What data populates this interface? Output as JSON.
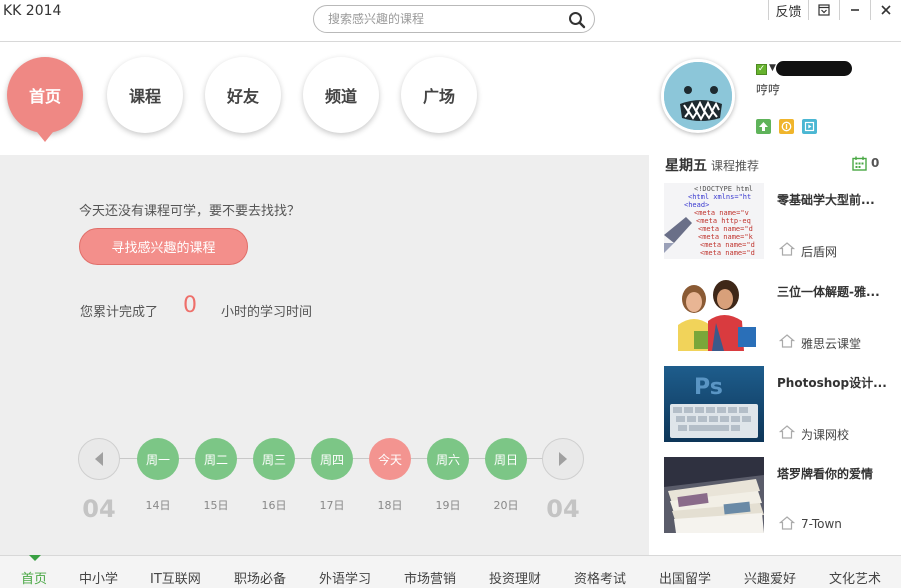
{
  "app": {
    "title": "KK 2014"
  },
  "search": {
    "placeholder": "搜索感兴趣的课程",
    "icon": "search-icon"
  },
  "window_controls": {
    "feedback": "反馈",
    "icons": [
      "dropdown-icon",
      "minimize-icon",
      "close-icon"
    ]
  },
  "nav": {
    "items": [
      {
        "label": "首页",
        "active": true
      },
      {
        "label": "课程",
        "active": false
      },
      {
        "label": "好友",
        "active": false
      },
      {
        "label": "频道",
        "active": false
      },
      {
        "label": "广场",
        "active": false
      }
    ],
    "accent_color": "#ef8884"
  },
  "user": {
    "nickname": "哼哼",
    "online_status": "online",
    "badges": [
      "upgrade-icon",
      "coin-icon",
      "video-icon"
    ]
  },
  "main": {
    "prompt": "今天还没有课程可学，要不要去找找？",
    "find_button": "寻找感兴趣的课程",
    "stat_prefix": "您累计完成了",
    "stat_value": "0",
    "stat_suffix": "小时的学习时间",
    "week": {
      "left_month": "04",
      "right_month": "04",
      "days": [
        {
          "label": "周一",
          "date": "14日"
        },
        {
          "label": "周二",
          "date": "15日"
        },
        {
          "label": "周三",
          "date": "16日"
        },
        {
          "label": "周四",
          "date": "17日"
        },
        {
          "label": "今天",
          "date": "18日",
          "today": true
        },
        {
          "label": "周六",
          "date": "19日"
        },
        {
          "label": "周日",
          "date": "20日"
        }
      ]
    }
  },
  "side": {
    "day": "星期五",
    "subtitle": "课程推荐",
    "calendar_count": "0",
    "courses": [
      {
        "title": "零基础学大型前...",
        "org": "后盾网",
        "thumb": "code-thumbnail"
      },
      {
        "title": "三位一体解题-雅...",
        "org": "雅思云课堂",
        "thumb": "students-thumbnail"
      },
      {
        "title": "Photoshop设计...",
        "org": "为课网校",
        "thumb": "photoshop-keyboard-thumbnail"
      },
      {
        "title": "塔罗牌看你的爱情",
        "org": "7-Town",
        "thumb": "tarot-cards-thumbnail"
      }
    ]
  },
  "categories": {
    "items": [
      "首页",
      "中小学",
      "IT互联网",
      "职场必备",
      "外语学习",
      "市场营销",
      "投资理财",
      "资格考试",
      "出国留学",
      "兴趣爱好",
      "文化艺术"
    ],
    "active_index": 0,
    "active_color": "#4aa845"
  }
}
